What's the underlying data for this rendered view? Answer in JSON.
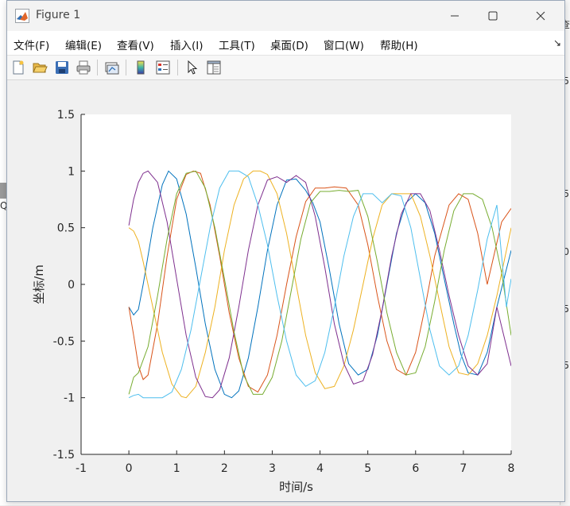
{
  "window": {
    "title": "Figure 1",
    "minimize_icon": "minimize-icon",
    "maximize_icon": "maximize-icon",
    "close_icon": "close-icon"
  },
  "menu": {
    "items": [
      "文件(F)",
      "编辑(E)",
      "查看(V)",
      "插入(I)",
      "工具(T)",
      "桌面(D)",
      "窗口(W)",
      "帮助(H)"
    ],
    "overflow_glyph": "↘"
  },
  "toolbar": {
    "icons": [
      "new-figure-icon",
      "open-file-icon",
      "save-icon",
      "print-icon",
      "link-plot-icon",
      "colorbar-icon",
      "legend-icon",
      "pointer-icon",
      "property-inspector-icon"
    ]
  },
  "background": {
    "fragments": [
      "查",
      "5",
      "5",
      "0",
      "5",
      "5",
      "Q"
    ]
  },
  "colors": {
    "series": [
      "#0072BD",
      "#D95319",
      "#EDB120",
      "#7E2F8E",
      "#77AC30",
      "#4DBEEE"
    ],
    "axes_bg": "#ffffff",
    "figure_bg": "#f0f0f0"
  },
  "chart_data": {
    "type": "line",
    "title": "",
    "xlabel": "时间/s",
    "ylabel": "坐标/m",
    "xlim": [
      -1,
      8
    ],
    "ylim": [
      -1.5,
      1.5
    ],
    "xticks": [
      -1,
      0,
      1,
      2,
      3,
      4,
      5,
      6,
      7,
      8
    ],
    "yticks": [
      -1.5,
      -1,
      -0.5,
      0,
      0.5,
      1,
      1.5
    ],
    "grid": false,
    "legend": null,
    "series": [
      {
        "x": [
          0.0,
          0.1,
          0.2,
          0.3,
          0.5,
          0.7,
          0.83,
          1.0,
          1.2,
          1.4,
          1.6,
          1.8,
          2.0,
          2.15,
          2.3,
          2.5,
          2.7,
          2.9,
          3.1,
          3.3,
          3.5,
          3.7,
          3.85,
          4.0,
          4.2,
          4.4,
          4.6,
          4.8,
          5.0,
          5.2,
          5.4,
          5.6,
          5.8,
          6.0,
          6.2,
          6.4,
          6.6,
          6.8,
          6.95,
          7.1,
          7.3,
          7.5,
          7.7,
          8.0
        ],
        "y": [
          -0.2,
          -0.27,
          -0.22,
          0.0,
          0.5,
          0.88,
          1.0,
          0.93,
          0.62,
          0.15,
          -0.35,
          -0.75,
          -0.97,
          -1.0,
          -0.94,
          -0.65,
          -0.2,
          0.3,
          0.7,
          0.92,
          0.93,
          0.83,
          0.72,
          0.55,
          0.12,
          -0.35,
          -0.7,
          -0.8,
          -0.75,
          -0.45,
          0.0,
          0.45,
          0.72,
          0.8,
          0.72,
          0.45,
          0.05,
          -0.35,
          -0.62,
          -0.78,
          -0.8,
          -0.6,
          -0.2,
          0.3
        ]
      },
      {
        "x": [
          0.0,
          0.1,
          0.2,
          0.3,
          0.4,
          0.6,
          0.8,
          1.0,
          1.2,
          1.35,
          1.5,
          1.7,
          1.9,
          2.1,
          2.3,
          2.5,
          2.7,
          2.9,
          3.1,
          3.3,
          3.5,
          3.7,
          3.9,
          4.1,
          4.3,
          4.55,
          4.8,
          5.0,
          5.2,
          5.4,
          5.6,
          5.8,
          6.0,
          6.2,
          6.4,
          6.7,
          6.9,
          7.1,
          7.3,
          7.5,
          7.8,
          8.0
        ],
        "y": [
          -0.2,
          -0.45,
          -0.72,
          -0.84,
          -0.8,
          -0.35,
          0.25,
          0.75,
          0.97,
          1.0,
          0.98,
          0.7,
          0.25,
          -0.25,
          -0.65,
          -0.9,
          -0.95,
          -0.8,
          -0.45,
          0.0,
          0.42,
          0.73,
          0.85,
          0.85,
          0.86,
          0.85,
          0.7,
          0.35,
          -0.1,
          -0.5,
          -0.75,
          -0.8,
          -0.6,
          -0.2,
          0.25,
          0.7,
          0.8,
          0.75,
          0.45,
          0.0,
          0.55,
          0.67
        ]
      },
      {
        "x": [
          0.0,
          0.1,
          0.2,
          0.3,
          0.5,
          0.7,
          0.9,
          1.1,
          1.2,
          1.4,
          1.6,
          1.8,
          2.0,
          2.2,
          2.4,
          2.6,
          2.75,
          2.9,
          3.1,
          3.3,
          3.5,
          3.7,
          3.9,
          4.1,
          4.3,
          4.5,
          4.7,
          4.9,
          5.1,
          5.3,
          5.5,
          5.7,
          5.9,
          6.1,
          6.3,
          6.5,
          6.7,
          6.9,
          7.1,
          7.3,
          7.5,
          7.7,
          8.0
        ],
        "y": [
          0.5,
          0.47,
          0.38,
          0.2,
          -0.2,
          -0.6,
          -0.88,
          -0.99,
          -1.0,
          -0.9,
          -0.6,
          -0.2,
          0.3,
          0.7,
          0.93,
          1.0,
          1.0,
          0.97,
          0.8,
          0.45,
          0.0,
          -0.45,
          -0.78,
          -0.92,
          -0.9,
          -0.72,
          -0.4,
          0.0,
          0.4,
          0.7,
          0.8,
          0.8,
          0.8,
          0.6,
          0.25,
          -0.15,
          -0.55,
          -0.78,
          -0.8,
          -0.7,
          -0.45,
          -0.1,
          0.5
        ]
      },
      {
        "x": [
          0.0,
          0.1,
          0.2,
          0.3,
          0.4,
          0.6,
          0.8,
          1.0,
          1.2,
          1.4,
          1.6,
          1.75,
          1.9,
          2.1,
          2.3,
          2.5,
          2.7,
          2.9,
          3.1,
          3.3,
          3.5,
          3.7,
          3.9,
          4.1,
          4.3,
          4.5,
          4.7,
          4.9,
          5.1,
          5.3,
          5.5,
          5.7,
          5.9,
          6.1,
          6.3,
          6.5,
          6.7,
          6.9,
          7.1,
          7.3,
          7.5,
          7.7,
          8.0
        ],
        "y": [
          0.52,
          0.75,
          0.9,
          0.98,
          1.0,
          0.9,
          0.55,
          0.05,
          -0.45,
          -0.82,
          -0.99,
          -1.0,
          -0.93,
          -0.65,
          -0.2,
          0.3,
          0.7,
          0.92,
          0.95,
          0.9,
          0.96,
          0.9,
          0.6,
          0.15,
          -0.35,
          -0.7,
          -0.88,
          -0.85,
          -0.62,
          -0.22,
          0.25,
          0.62,
          0.8,
          0.8,
          0.65,
          0.3,
          -0.1,
          -0.45,
          -0.72,
          -0.8,
          -0.7,
          -0.2,
          -0.72
        ]
      },
      {
        "x": [
          0.0,
          0.1,
          0.2,
          0.4,
          0.6,
          0.8,
          1.0,
          1.2,
          1.4,
          1.6,
          1.8,
          2.0,
          2.2,
          2.4,
          2.6,
          2.8,
          3.0,
          3.2,
          3.4,
          3.6,
          3.8,
          4.0,
          4.2,
          4.4,
          4.6,
          4.8,
          5.0,
          5.2,
          5.4,
          5.6,
          5.8,
          6.0,
          6.2,
          6.4,
          6.6,
          6.8,
          7.0,
          7.2,
          7.4,
          7.6,
          7.8,
          8.0
        ],
        "y": [
          -0.97,
          -0.82,
          -0.78,
          -0.55,
          -0.1,
          0.4,
          0.8,
          0.98,
          1.0,
          0.85,
          0.5,
          0.05,
          -0.42,
          -0.8,
          -0.97,
          -0.97,
          -0.82,
          -0.5,
          -0.05,
          0.4,
          0.72,
          0.82,
          0.82,
          0.83,
          0.82,
          0.83,
          0.6,
          0.2,
          -0.25,
          -0.6,
          -0.8,
          -0.78,
          -0.55,
          -0.15,
          0.3,
          0.65,
          0.8,
          0.8,
          0.75,
          0.5,
          0.1,
          -0.45
        ]
      },
      {
        "x": [
          0.0,
          0.1,
          0.2,
          0.3,
          0.5,
          0.7,
          0.9,
          1.1,
          1.3,
          1.5,
          1.7,
          1.9,
          2.1,
          2.3,
          2.5,
          2.7,
          2.9,
          3.1,
          3.3,
          3.5,
          3.7,
          3.9,
          4.1,
          4.3,
          4.5,
          4.7,
          4.9,
          5.1,
          5.3,
          5.5,
          5.7,
          5.9,
          6.1,
          6.3,
          6.5,
          6.7,
          6.9,
          7.1,
          7.3,
          7.5,
          7.7,
          7.9,
          8.0
        ],
        "y": [
          -1.0,
          -0.98,
          -0.97,
          -1.0,
          -1.0,
          -1.0,
          -0.95,
          -0.75,
          -0.4,
          0.05,
          0.5,
          0.85,
          1.0,
          1.0,
          0.95,
          0.7,
          0.35,
          -0.1,
          -0.5,
          -0.8,
          -0.9,
          -0.85,
          -0.6,
          -0.2,
          0.25,
          0.6,
          0.8,
          0.8,
          0.72,
          0.8,
          0.78,
          0.5,
          0.05,
          -0.4,
          -0.72,
          -0.8,
          -0.72,
          -0.45,
          -0.05,
          0.4,
          0.7,
          -0.2,
          0.05
        ]
      }
    ]
  }
}
